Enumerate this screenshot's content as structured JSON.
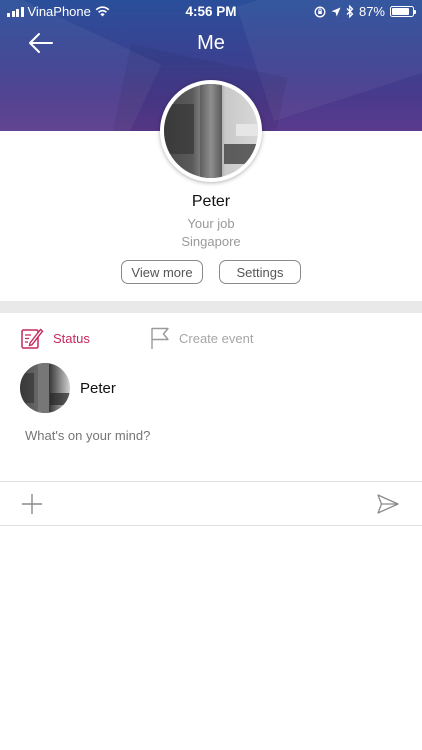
{
  "status_bar": {
    "carrier": "VinaPhone",
    "time": "4:56 PM",
    "battery_percent": "87%",
    "battery_level": 0.87,
    "icons": [
      "signal-icon",
      "wifi-icon",
      "orientation-lock-icon",
      "location-icon",
      "bluetooth-icon",
      "battery-icon"
    ]
  },
  "header": {
    "title": "Me",
    "back_icon": "arrow-left-icon"
  },
  "profile": {
    "name": "Peter",
    "job": "Your job",
    "location": "Singapore",
    "view_more_label": "View more",
    "settings_label": "Settings"
  },
  "composer": {
    "tabs": [
      {
        "label": "Status",
        "icon": "edit-note-icon",
        "active": true
      },
      {
        "label": "Create event",
        "icon": "flag-icon",
        "active": false
      }
    ],
    "author": "Peter",
    "placeholder": "What's on your mind?",
    "add_icon": "plus-icon",
    "send_icon": "send-icon"
  },
  "colors": {
    "accent": "#c6285e",
    "header_top": "#2a4f9a",
    "header_bottom": "#5a3a8d",
    "muted_text": "#9a9a9a"
  }
}
